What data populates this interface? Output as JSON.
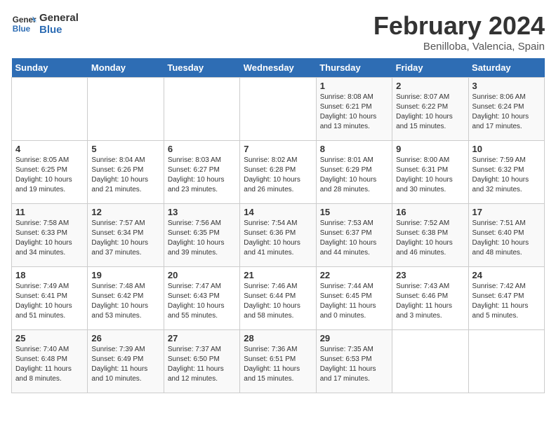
{
  "header": {
    "logo_line1": "General",
    "logo_line2": "Blue",
    "month_title": "February 2024",
    "subtitle": "Benilloba, Valencia, Spain"
  },
  "weekdays": [
    "Sunday",
    "Monday",
    "Tuesday",
    "Wednesday",
    "Thursday",
    "Friday",
    "Saturday"
  ],
  "weeks": [
    [
      {
        "day": "",
        "info": ""
      },
      {
        "day": "",
        "info": ""
      },
      {
        "day": "",
        "info": ""
      },
      {
        "day": "",
        "info": ""
      },
      {
        "day": "1",
        "info": "Sunrise: 8:08 AM\nSunset: 6:21 PM\nDaylight: 10 hours\nand 13 minutes."
      },
      {
        "day": "2",
        "info": "Sunrise: 8:07 AM\nSunset: 6:22 PM\nDaylight: 10 hours\nand 15 minutes."
      },
      {
        "day": "3",
        "info": "Sunrise: 8:06 AM\nSunset: 6:24 PM\nDaylight: 10 hours\nand 17 minutes."
      }
    ],
    [
      {
        "day": "4",
        "info": "Sunrise: 8:05 AM\nSunset: 6:25 PM\nDaylight: 10 hours\nand 19 minutes."
      },
      {
        "day": "5",
        "info": "Sunrise: 8:04 AM\nSunset: 6:26 PM\nDaylight: 10 hours\nand 21 minutes."
      },
      {
        "day": "6",
        "info": "Sunrise: 8:03 AM\nSunset: 6:27 PM\nDaylight: 10 hours\nand 23 minutes."
      },
      {
        "day": "7",
        "info": "Sunrise: 8:02 AM\nSunset: 6:28 PM\nDaylight: 10 hours\nand 26 minutes."
      },
      {
        "day": "8",
        "info": "Sunrise: 8:01 AM\nSunset: 6:29 PM\nDaylight: 10 hours\nand 28 minutes."
      },
      {
        "day": "9",
        "info": "Sunrise: 8:00 AM\nSunset: 6:31 PM\nDaylight: 10 hours\nand 30 minutes."
      },
      {
        "day": "10",
        "info": "Sunrise: 7:59 AM\nSunset: 6:32 PM\nDaylight: 10 hours\nand 32 minutes."
      }
    ],
    [
      {
        "day": "11",
        "info": "Sunrise: 7:58 AM\nSunset: 6:33 PM\nDaylight: 10 hours\nand 34 minutes."
      },
      {
        "day": "12",
        "info": "Sunrise: 7:57 AM\nSunset: 6:34 PM\nDaylight: 10 hours\nand 37 minutes."
      },
      {
        "day": "13",
        "info": "Sunrise: 7:56 AM\nSunset: 6:35 PM\nDaylight: 10 hours\nand 39 minutes."
      },
      {
        "day": "14",
        "info": "Sunrise: 7:54 AM\nSunset: 6:36 PM\nDaylight: 10 hours\nand 41 minutes."
      },
      {
        "day": "15",
        "info": "Sunrise: 7:53 AM\nSunset: 6:37 PM\nDaylight: 10 hours\nand 44 minutes."
      },
      {
        "day": "16",
        "info": "Sunrise: 7:52 AM\nSunset: 6:38 PM\nDaylight: 10 hours\nand 46 minutes."
      },
      {
        "day": "17",
        "info": "Sunrise: 7:51 AM\nSunset: 6:40 PM\nDaylight: 10 hours\nand 48 minutes."
      }
    ],
    [
      {
        "day": "18",
        "info": "Sunrise: 7:49 AM\nSunset: 6:41 PM\nDaylight: 10 hours\nand 51 minutes."
      },
      {
        "day": "19",
        "info": "Sunrise: 7:48 AM\nSunset: 6:42 PM\nDaylight: 10 hours\nand 53 minutes."
      },
      {
        "day": "20",
        "info": "Sunrise: 7:47 AM\nSunset: 6:43 PM\nDaylight: 10 hours\nand 55 minutes."
      },
      {
        "day": "21",
        "info": "Sunrise: 7:46 AM\nSunset: 6:44 PM\nDaylight: 10 hours\nand 58 minutes."
      },
      {
        "day": "22",
        "info": "Sunrise: 7:44 AM\nSunset: 6:45 PM\nDaylight: 11 hours\nand 0 minutes."
      },
      {
        "day": "23",
        "info": "Sunrise: 7:43 AM\nSunset: 6:46 PM\nDaylight: 11 hours\nand 3 minutes."
      },
      {
        "day": "24",
        "info": "Sunrise: 7:42 AM\nSunset: 6:47 PM\nDaylight: 11 hours\nand 5 minutes."
      }
    ],
    [
      {
        "day": "25",
        "info": "Sunrise: 7:40 AM\nSunset: 6:48 PM\nDaylight: 11 hours\nand 8 minutes."
      },
      {
        "day": "26",
        "info": "Sunrise: 7:39 AM\nSunset: 6:49 PM\nDaylight: 11 hours\nand 10 minutes."
      },
      {
        "day": "27",
        "info": "Sunrise: 7:37 AM\nSunset: 6:50 PM\nDaylight: 11 hours\nand 12 minutes."
      },
      {
        "day": "28",
        "info": "Sunrise: 7:36 AM\nSunset: 6:51 PM\nDaylight: 11 hours\nand 15 minutes."
      },
      {
        "day": "29",
        "info": "Sunrise: 7:35 AM\nSunset: 6:53 PM\nDaylight: 11 hours\nand 17 minutes."
      },
      {
        "day": "",
        "info": ""
      },
      {
        "day": "",
        "info": ""
      }
    ]
  ]
}
